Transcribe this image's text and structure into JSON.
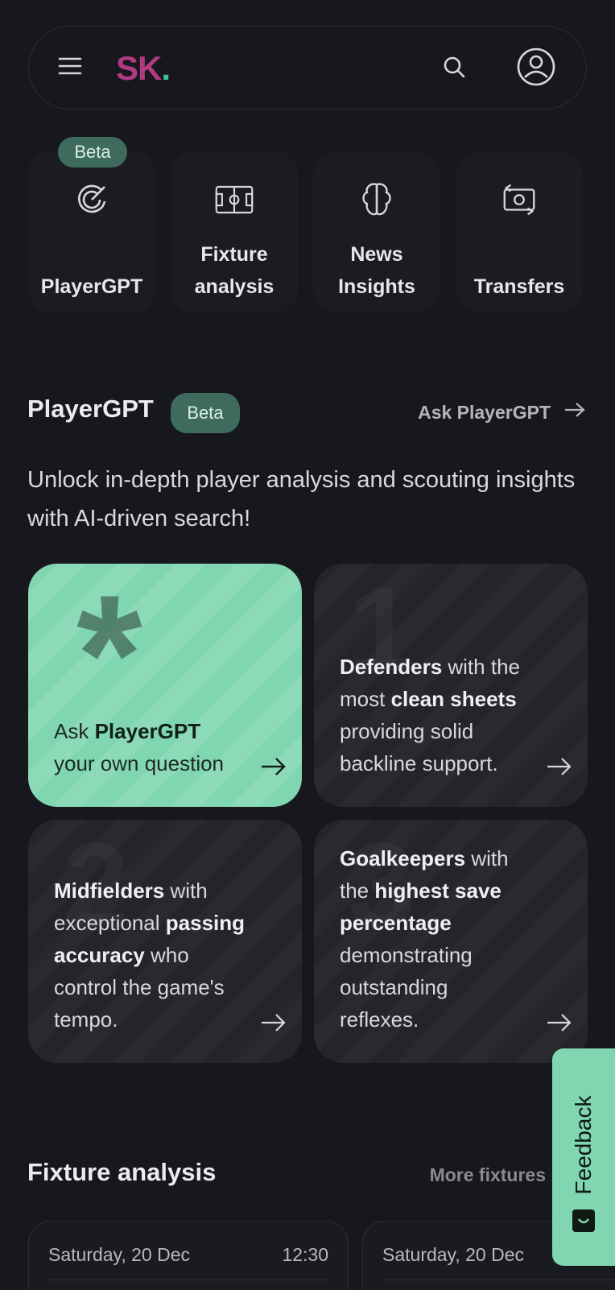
{
  "header": {
    "logo_text": "SK",
    "logo_dot": ".",
    "brand_colors": {
      "logo": "#b13a80",
      "dot": "#3fbfa0"
    },
    "icons": {
      "menu": "hamburger-icon",
      "search": "search-icon",
      "user": "user-icon"
    }
  },
  "quick_links": [
    {
      "label": "PlayerGPT",
      "icon": "playergpt-icon",
      "badge": "Beta"
    },
    {
      "label": "Fixture\nanalysis",
      "icon": "pitch-icon"
    },
    {
      "label": "News\nInsights",
      "icon": "brain-icon"
    },
    {
      "label": "Transfers",
      "icon": "transfer-icon"
    }
  ],
  "playergpt": {
    "title": "PlayerGPT",
    "badge": "Beta",
    "link_label": "Ask PlayerGPT",
    "intro": "Unlock in-depth player analysis and scouting insights with AI-driven search!",
    "cards": [
      {
        "pre": "Ask ",
        "bold1": "PlayerGPT",
        "mid1": " your own question",
        "bold2": "",
        "mid2": "",
        "bold3": "",
        "post": ""
      },
      {
        "pre": "",
        "bold1": "Defenders",
        "mid1": " with the most ",
        "bold2": "clean sheets",
        "mid2": " providing solid backline support.",
        "bold3": "",
        "post": ""
      },
      {
        "pre": "",
        "bold1": "Midfielders",
        "mid1": " with exceptional ",
        "bold2": "passing accuracy",
        "mid2": " who control the game's tempo.",
        "bold3": "",
        "post": ""
      },
      {
        "pre": "",
        "bold1": "Goalkeepers",
        "mid1": " with the ",
        "bold2": "highest save percentage",
        "mid2": " demonstrating outstanding reflexes.",
        "bold3": "",
        "post": ""
      }
    ],
    "accent_color": "#7fd6b0"
  },
  "fixtures": {
    "title": "Fixture analysis",
    "link_label": "More fixtures",
    "items": [
      {
        "date": "Saturday, 20 Dec",
        "time": "12:30"
      },
      {
        "date": "Saturday, 20 Dec",
        "time": ""
      }
    ]
  },
  "feedback": {
    "label": "Feedback",
    "icon": "feedback-icon"
  }
}
